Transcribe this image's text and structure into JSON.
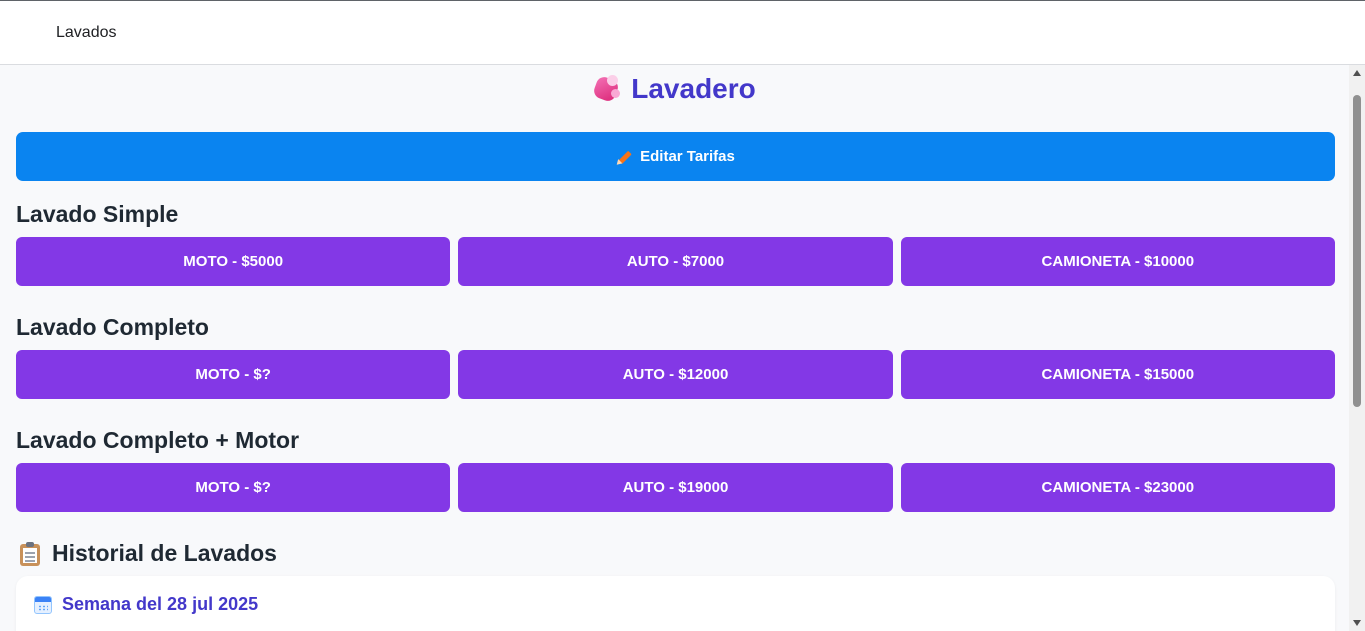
{
  "topbar": {
    "title": "Lavados"
  },
  "app": {
    "title": "Lavadero",
    "logo_icon": "droplets-icon"
  },
  "edit_button": {
    "label": "Editar Tarifas",
    "icon": "pencil-icon"
  },
  "sections": [
    {
      "title": "Lavado Simple",
      "buttons": [
        "MOTO - $5000",
        "AUTO - $7000",
        "CAMIONETA - $10000"
      ]
    },
    {
      "title": "Lavado Completo",
      "buttons": [
        "MOTO - $?",
        "AUTO - $12000",
        "CAMIONETA - $15000"
      ]
    },
    {
      "title": "Lavado Completo + Motor",
      "buttons": [
        "MOTO - $?",
        "AUTO - $19000",
        "CAMIONETA - $23000"
      ]
    }
  ],
  "history": {
    "title": "Historial de Lavados",
    "icon": "clipboard-icon",
    "week_label": "Semana del 28 jul 2025",
    "week_icon": "calendar-icon"
  },
  "colors": {
    "accent_purple": "#8338e6",
    "accent_blue": "#0a84f0",
    "title_indigo": "#4338ca"
  }
}
